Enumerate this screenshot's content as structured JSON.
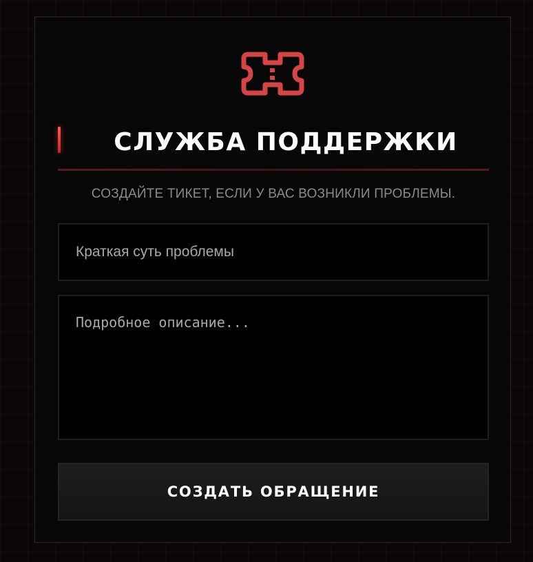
{
  "header": {
    "logo_icon": "ticket-icon",
    "title": "СЛУЖБА ПОДДЕРЖКИ",
    "subtitle": "СОЗДАЙТЕ ТИКЕТ, ЕСЛИ У ВАС ВОЗНИКЛИ ПРОБЛЕМЫ."
  },
  "form": {
    "subject": {
      "value": "",
      "placeholder": "Краткая суть проблемы"
    },
    "description": {
      "value": "",
      "placeholder": "Подробное описание..."
    },
    "submit_label": "СОЗДАТЬ ОБРАЩЕНИЕ"
  },
  "colors": {
    "accent": "#d64545",
    "background": "#0b0707",
    "card": "#070707",
    "field_border": "#1f1f1f"
  }
}
